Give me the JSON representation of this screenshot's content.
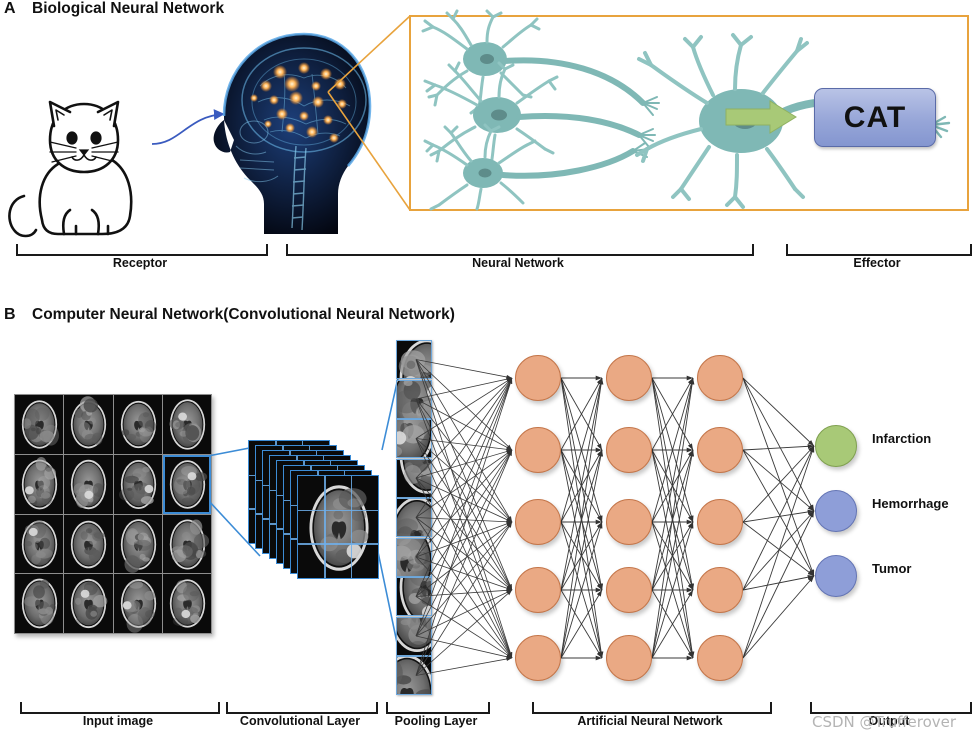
{
  "figure": {
    "panels": [
      {
        "letter": "A",
        "title": "Biological Neural Network",
        "result_box_label": "CAT",
        "brackets": [
          {
            "label": "Receptor"
          },
          {
            "label": "Neural Network"
          },
          {
            "label": "Effector"
          }
        ]
      },
      {
        "letter": "B",
        "title": "Computer Neural Network(Convolutional Neural Network)",
        "brackets": [
          {
            "label": "Input image"
          },
          {
            "label": "Convolutional Layer"
          },
          {
            "label": "Pooling Layer"
          },
          {
            "label": "Artificial Neural Network"
          },
          {
            "label": "Output"
          }
        ],
        "outputs": [
          {
            "label": "Infarction",
            "color": "#A8C977"
          },
          {
            "label": "Hemorrhage",
            "color": "#8E9ED8"
          },
          {
            "label": "Tumor",
            "color": "#8E9ED8"
          }
        ]
      }
    ]
  },
  "watermark": {
    "text": "CSDN @Trufferover"
  },
  "colors": {
    "accent_orange": "#E8A33D",
    "neuron_teal": "#74B0AE",
    "node_peach": "#EAA984",
    "node_green": "#A8C977",
    "node_blue": "#8E9ED8",
    "link_blue": "#3C8CD6",
    "arrow_green": "#A8C977"
  }
}
